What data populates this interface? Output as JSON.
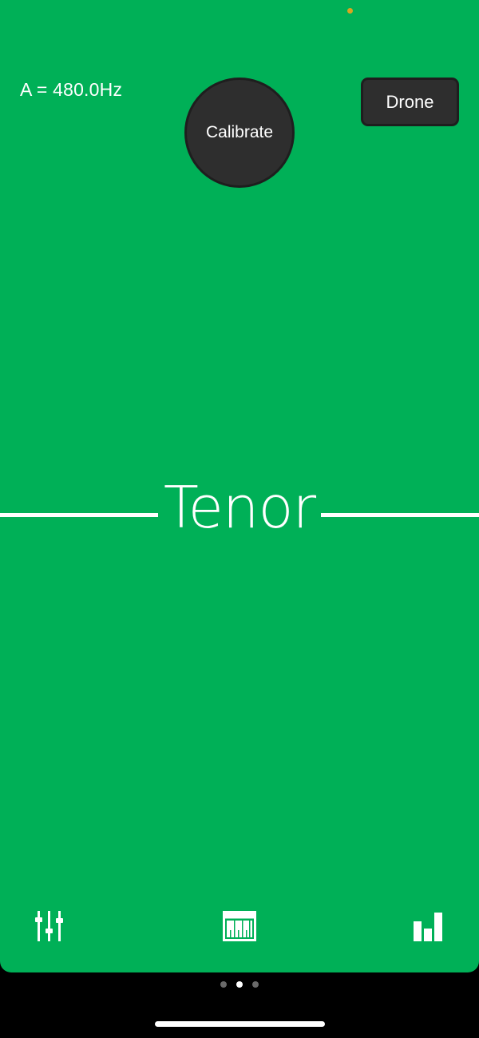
{
  "header": {
    "reference_label": "A = 480.0Hz",
    "calibrate_label": "Calibrate",
    "drone_label": "Drone"
  },
  "main": {
    "mode_title": "Tenor"
  },
  "colors": {
    "background": "#00b057",
    "button": "#2e2e2e",
    "status_dot": "#d9a521"
  },
  "toolbar": {
    "icons": [
      "sliders-icon",
      "piano-keyboard-icon",
      "bar-chart-icon"
    ]
  },
  "pager": {
    "count": 3,
    "active_index": 1
  }
}
